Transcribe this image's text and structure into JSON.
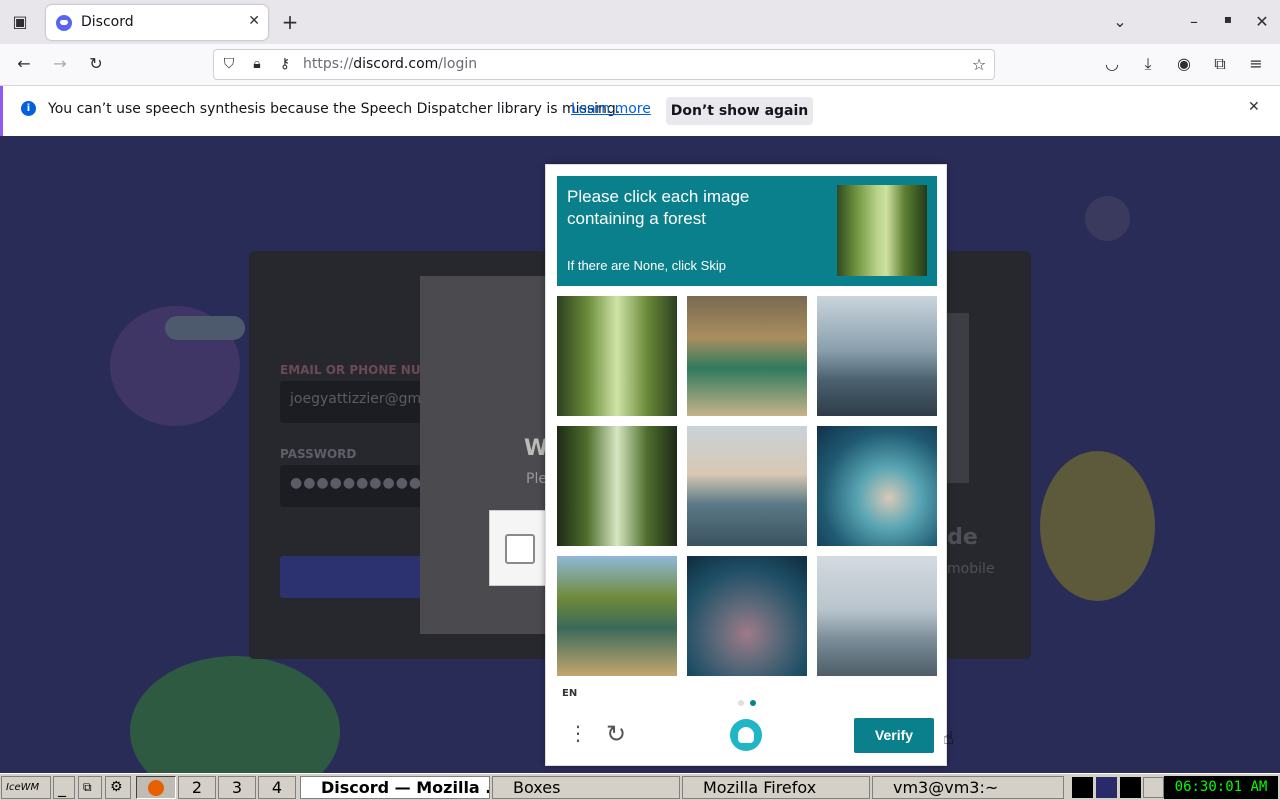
{
  "browser": {
    "tab_title": "Discord",
    "tab_close": "✕",
    "new_tab": "+",
    "url_domain": "discord.com",
    "url_prefix": "https://",
    "url_path": "/login",
    "window_controls": [
      "–",
      "▪",
      "✕"
    ]
  },
  "notification": {
    "message": "You can’t use speech synthesis because the Speech Dispatcher library is missing.",
    "learn_more": "Learn more",
    "dont_show": "Don’t show again",
    "close": "✕"
  },
  "background_page": {
    "email_label": "EMAIL OR PHONE NUMBE",
    "email_value": "joegyattizzier@gm",
    "password_label": "PASSWORD",
    "password_value": "●●●●●●●●●●●●●",
    "welcome_partial": "W",
    "please_partial": "Ple",
    "code_partial": "ode",
    "mobile_partial": "mobile"
  },
  "captcha": {
    "prompt": "Please click each image containing a forest",
    "subtext": "If there are None, click Skip",
    "language": "EN",
    "verify_label": "Verify",
    "accent_color": "#0b808d",
    "tiles": [
      {
        "subject": "bamboo forest path"
      },
      {
        "subject": "canyon lake"
      },
      {
        "subject": "coastal sea"
      },
      {
        "subject": "bamboo forest path"
      },
      {
        "subject": "calm sea"
      },
      {
        "subject": "coral reef"
      },
      {
        "subject": "river in desert"
      },
      {
        "subject": "coral reef"
      },
      {
        "subject": "sea with boat"
      }
    ]
  },
  "taskbar": {
    "desktops": [
      "2",
      "3",
      "4"
    ],
    "windows": [
      "Discord — Mozilla ...",
      "Boxes",
      "Mozilla Firefox",
      "vm3@vm3:~"
    ],
    "clock": "06:30:01 AM"
  }
}
